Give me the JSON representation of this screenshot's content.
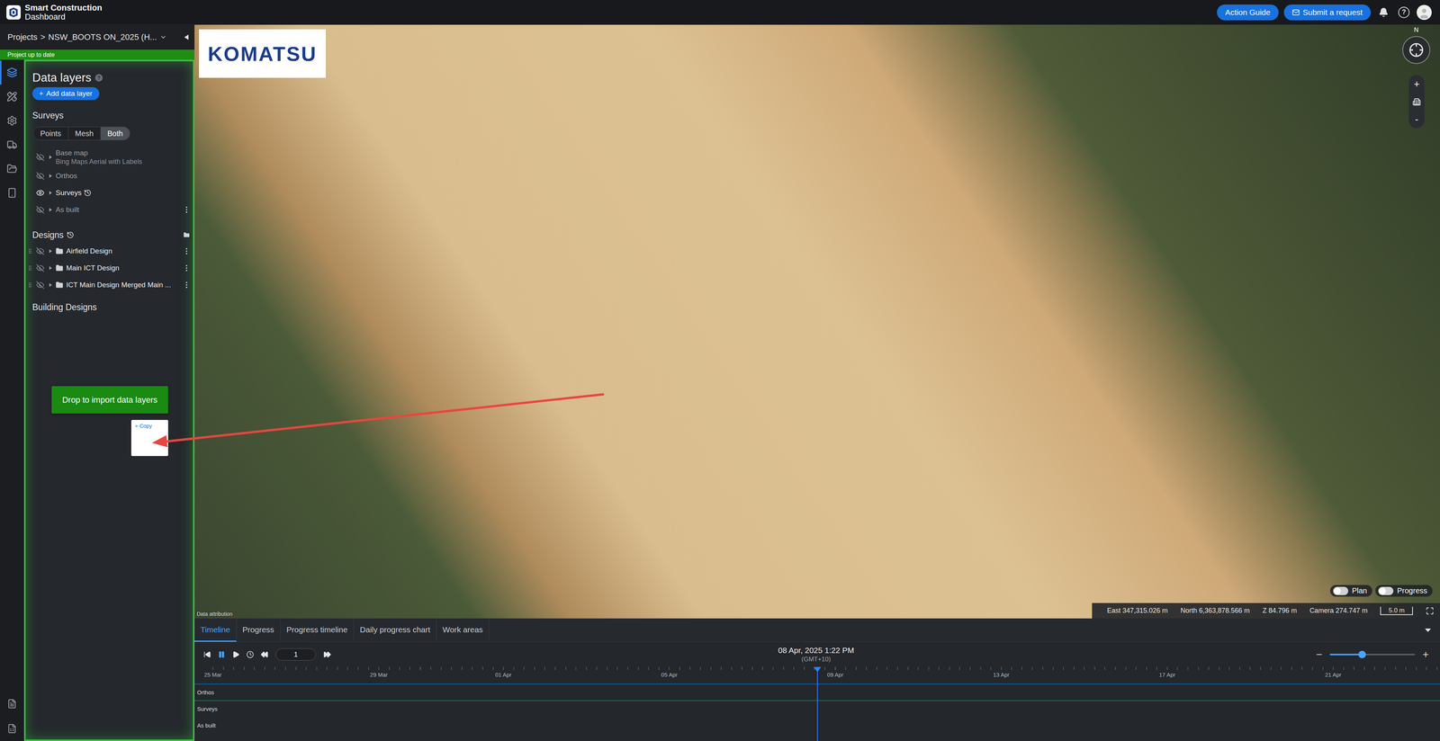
{
  "topbar": {
    "brand": {
      "line1": "Smart Construction",
      "line2": "Dashboard"
    },
    "buttons": [
      {
        "label": "Action Guide",
        "kind": "plain"
      },
      {
        "label": "Submit a request",
        "kind": "mail"
      }
    ],
    "help": "?"
  },
  "project": {
    "crumb": "Projects",
    "separator": ">",
    "name": "NSW_BOOTS ON_2025 (H...",
    "status": "Project up to date"
  },
  "rail": {
    "top": [
      {
        "selected": true
      },
      {
        "selected": false
      },
      {
        "selected": false
      },
      {
        "selected": false
      },
      {
        "selected": false
      },
      {
        "selected": false
      }
    ],
    "bottom": [
      {
        "selected": false
      },
      {
        "selected": false
      }
    ]
  },
  "data_layers": {
    "title": "Data layers",
    "help": "?",
    "add_button": {
      "icon": "+",
      "label": "Add data layer"
    },
    "drag_active": true,
    "drop_hint": "Drop to import data layers",
    "drag_ghost": {
      "icon": "+",
      "label": "Copy"
    },
    "surveys": {
      "label": "Surveys",
      "modes": [
        {
          "label": "Points",
          "selected": false
        },
        {
          "label": "Mesh",
          "selected": false
        },
        {
          "label": "Both",
          "selected": true
        }
      ],
      "layers": [
        {
          "name": "Base map",
          "sub": "Bing Maps Aerial with Labels",
          "visible": false,
          "expanded": false,
          "history": false,
          "menu": false
        },
        {
          "name": "Orthos",
          "visible": false,
          "expanded": false,
          "history": false,
          "menu": false
        },
        {
          "name": "Surveys",
          "visible": true,
          "expanded": false,
          "history": true,
          "menu": false
        },
        {
          "name": "As built",
          "visible": false,
          "expanded": false,
          "history": false,
          "menu": true
        }
      ]
    },
    "designs": {
      "label": "Designs",
      "history": true,
      "items": [
        {
          "name": "Airfield Design",
          "visible": false,
          "expanded": false
        },
        {
          "name": "Main ICT Design",
          "visible": false,
          "expanded": false
        },
        {
          "name": "ICT Main Design Merged Main ...",
          "visible": false,
          "expanded": false
        }
      ]
    },
    "building_designs": {
      "label": "Building Designs"
    }
  },
  "map": {
    "logo": "KOMATSU",
    "north": "N",
    "zoom_in": "+",
    "zoom_out": "-",
    "attribution": "Data attribution",
    "toggles": [
      {
        "label": "Plan",
        "on": false
      },
      {
        "label": "Progress",
        "on": false
      }
    ],
    "coords": [
      "East 347,315.026 m",
      "North 6,363,878.566 m",
      "Z 84.796 m",
      "Camera 274.747 m"
    ],
    "scale": "5.0 m"
  },
  "timeline": {
    "tabs": [
      {
        "label": "Timeline",
        "selected": true
      },
      {
        "label": "Progress",
        "selected": false
      },
      {
        "label": "Progress timeline",
        "selected": false
      },
      {
        "label": "Daily progress chart",
        "selected": false
      },
      {
        "label": "Work areas",
        "selected": false
      }
    ],
    "playing": true,
    "step": "1",
    "date": "08 Apr, 2025 1:22 PM",
    "timezone": "(GMT+10)",
    "zoom": {
      "out": "−",
      "in": "+",
      "level": 0.38
    },
    "ticks": [
      "25 Mar",
      "29 Mar",
      "01 Apr",
      "05 Apr",
      "09 Apr",
      "13 Apr",
      "17 Apr",
      "21 Apr"
    ],
    "cursor": 0.5,
    "rows": [
      {
        "label": "Orthos",
        "color": "#1d4d78"
      },
      {
        "label": "Surveys",
        "color": "#1f5c47"
      },
      {
        "label": "As built"
      }
    ]
  }
}
